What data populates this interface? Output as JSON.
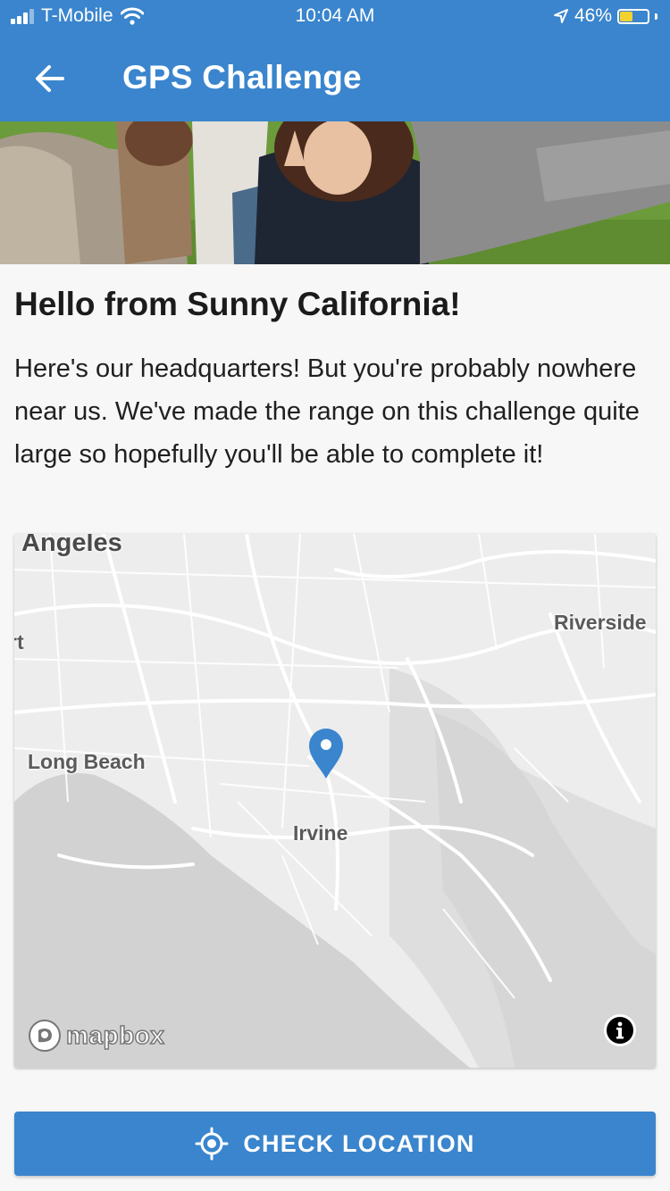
{
  "status_bar": {
    "carrier": "T-Mobile",
    "time": "10:04 AM",
    "battery": "46%",
    "battery_level": 0.46
  },
  "app_bar": {
    "title": "GPS Challenge",
    "back_icon": "arrow-left-icon"
  },
  "hero": {
    "description_icon": "group-selfie-photo"
  },
  "content": {
    "title": "Hello from Sunny California!",
    "body": "Here's our headquarters! But you're probably nowhere near us. We've made the range on this challenge quite large so hopefully you'll be able to complete it!"
  },
  "map": {
    "labels": {
      "angeles": "Angeles",
      "riverside": "Riverside",
      "long_beach": "Long Beach",
      "irvine": "Irvine",
      "edge": "rt"
    },
    "logo_text": "mapbox",
    "info_icon": "info-icon",
    "marker_icon": "map-pin-icon",
    "marker_color": "#3a85cd"
  },
  "check_location": {
    "label": "CHECK LOCATION",
    "icon": "crosshair-icon"
  },
  "colors": {
    "primary": "#3a85cd",
    "battery_charging": "#f2d230"
  }
}
